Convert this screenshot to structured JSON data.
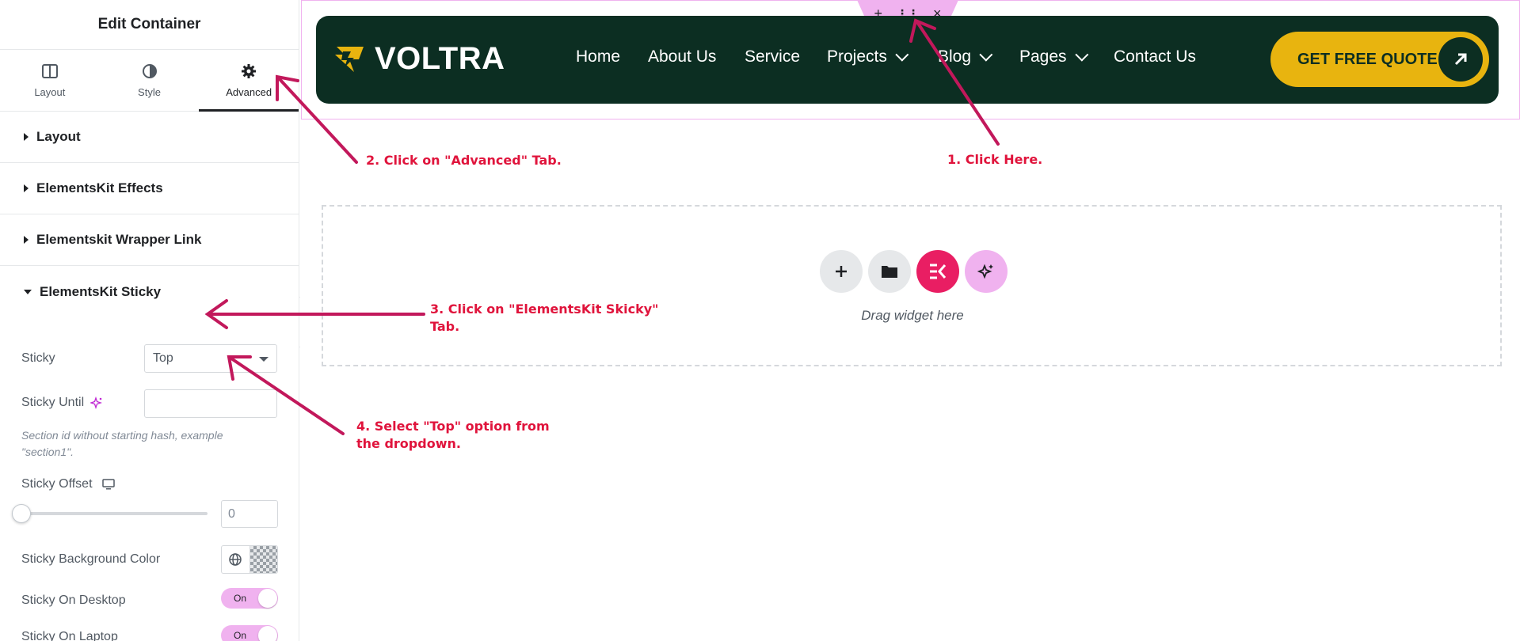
{
  "panel": {
    "title": "Edit Container",
    "tabs": [
      {
        "label": "Layout",
        "icon": "layout-icon"
      },
      {
        "label": "Style",
        "icon": "style-icon"
      },
      {
        "label": "Advanced",
        "icon": "gear-icon",
        "active": true
      }
    ],
    "sections": [
      {
        "label": "Layout",
        "open": false
      },
      {
        "label": "ElementsKit Effects",
        "open": false
      },
      {
        "label": "Elementskit Wrapper Link",
        "open": false
      },
      {
        "label": "ElementsKit Sticky",
        "open": true
      }
    ],
    "sticky": {
      "sticky_label": "Sticky",
      "sticky_value": "Top",
      "sticky_until_label": "Sticky Until",
      "sticky_until_value": "",
      "help_text": "Section id without starting hash, example \"section1\".",
      "offset_label": "Sticky Offset",
      "offset_value": "0",
      "bg_color_label": "Sticky Background Color",
      "on_desktop_label": "Sticky On Desktop",
      "on_desktop_value": "On",
      "on_laptop_label": "Sticky On Laptop",
      "on_laptop_value": "On"
    }
  },
  "preview": {
    "logo_text": "VOLTRA",
    "nav": [
      "Home",
      "About Us",
      "Service",
      "Projects",
      "Blog",
      "Pages",
      "Contact Us"
    ],
    "cta_label": "GET FREE QUOTE",
    "dropzone_text": "Drag widget here",
    "handle_icons": [
      "+",
      "⋮⋮",
      "×"
    ]
  },
  "annotations": {
    "step1": "1. Click Here.",
    "step2": "2. Click on \"Advanced\" Tab.",
    "step3_line1": "3. Click on \"ElementsKit Skicky\"",
    "step3_line2": "Tab.",
    "step4_line1": "4. Select \"Top\" option from",
    "step4_line2": "the dropdown."
  },
  "colors": {
    "header_bg": "#0c2e22",
    "cta_bg": "#e8b40f",
    "accent_pink": "#f0b2ef",
    "annotation_red": "#e0143c",
    "arrow_magenta": "#c2185b",
    "ekit_red": "#e91e63"
  }
}
